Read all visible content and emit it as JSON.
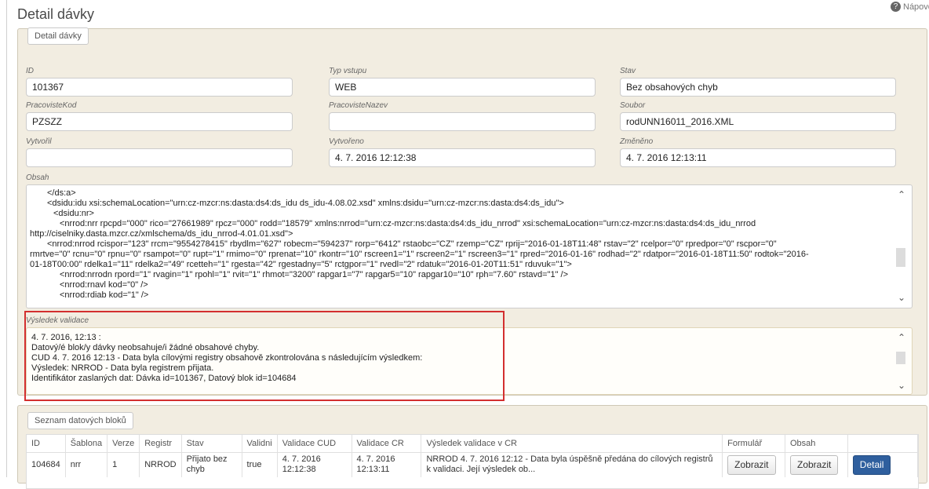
{
  "page": {
    "title": "Detail dávky",
    "help_label": "Nápověda"
  },
  "detail": {
    "legend": "Detail dávky",
    "fields": {
      "id": {
        "label": "ID",
        "value": "101367"
      },
      "typ_vstupu": {
        "label": "Typ vstupu",
        "value": "WEB"
      },
      "stav": {
        "label": "Stav",
        "value": "Bez obsahových chyb"
      },
      "pracoviste_kod": {
        "label": "PracovisteKod",
        "value": "PZSZZ"
      },
      "pracoviste_nazev": {
        "label": "PracovisteNazev",
        "value": ""
      },
      "soubor": {
        "label": "Soubor",
        "value": "rodUNN16011_2016.XML"
      },
      "vytvoril": {
        "label": "Vytvořil",
        "value": ""
      },
      "vytvoreno": {
        "label": "Vytvořeno",
        "value": "4. 7. 2016 12:12:38"
      },
      "zmeneno": {
        "label": "Změněno",
        "value": "4. 7. 2016 12:13:11"
      }
    },
    "obsah": {
      "label": "Obsah",
      "lines": [
        "</ds:a>",
        "<dsidu:idu xsi:schemaLocation=\"urn:cz-mzcr:ns:dasta:ds4:ds_idu ds_idu-4.08.02.xsd\" xmlns:dsidu=\"urn:cz-mzcr:ns:dasta:ds4:ds_idu\">",
        "<dsidu:nr>",
        "<nrrod:nrr rpcpd=\"000\" rico=\"27661989\" rpcz=\"000\" rodd=\"18579\" xmlns:nrrod=\"urn:cz-mzcr:ns:dasta:ds4:ds_idu_nrrod\" xsi:schemaLocation=\"urn:cz-mzcr:ns:dasta:ds4:ds_idu_nrrod",
        "http://ciselniky.dasta.mzcr.cz/xmlschema/ds_idu_nrrod-4.01.01.xsd\">",
        "<nrrod:nrrod rcispor=\"123\" rrcm=\"9554278415\" rbydlm=\"627\" robecm=\"594237\" rorp=\"6412\" rstaobc=\"CZ\" rzemp=\"CZ\" rprij=\"2016-01-18T11:48\" rstav=\"2\" rcelpor=\"0\" rpredpor=\"0\" rscpor=\"0\"",
        "rmrtve=\"0\" rcnu=\"0\" rpnu=\"0\" rsampot=\"0\" rupt=\"1\" rmimo=\"0\" rprenat=\"10\" rkontr=\"10\" rscreen1=\"1\" rscreen2=\"1\" rscreen3=\"1\" rpred=\"2016-01-16\" rodhad=\"2\" rdatpor=\"2016-01-18T11:50\" rodtok=\"2016-",
        "01-18T00:00\" rdelka1=\"11\" rdelka2=\"49\" rcetteh=\"1\" rgesta=\"42\" rgestadny=\"5\" rctgpor=\"1\" rvedl=\"2\" rdatuk=\"2016-01-20T11:51\" rduvuk=\"1\">",
        "<nrrod:nrrodn rpord=\"1\" rvagin=\"1\" rpohl=\"1\" rvit=\"1\" rhmot=\"3200\" rapgar1=\"7\" rapgar5=\"10\" rapgar10=\"10\" rph=\"7.60\" rstavd=\"1\" />",
        "<nrrod:rnavl kod=\"0\" />",
        "<nrrod:rdiab kod=\"1\" />"
      ]
    },
    "validace": {
      "label": "Výsledek validace",
      "lines": [
        "4. 7. 2016, 12:13 :",
        "Datový/é blok/y dávky neobsahuje/i žádné obsahové chyby.",
        "CUD 4. 7. 2016 12:13 - Data byla cílovými registry obsahově zkontrolována s následujícím výsledkem:",
        "Výsledek: NRROD - Data byla registrem přijata.",
        "Identifikátor zaslaných dat: Dávka id=101367, Datový blok id=104684"
      ]
    }
  },
  "bloky": {
    "legend": "Seznam datových bloků",
    "columns": [
      "ID",
      "Šablona",
      "Verze",
      "Registr",
      "Stav",
      "Validni",
      "Validace CUD",
      "Validace CR",
      "Výsledek validace v CR",
      "Formulář",
      "Obsah",
      ""
    ],
    "rows": [
      {
        "id": "104684",
        "sablona": "nrr",
        "verze": "1",
        "registr": "NRROD",
        "stav": "Přijato bez chyb",
        "validni": "true",
        "validace_cud": "4. 7. 2016 12:12:38",
        "validace_cr": "4. 7. 2016 12:13:11",
        "vysledek": "NRROD 4. 7. 2016 12:12 - Data byla úspěšně předána do cílových registrů k validaci. Její výsledek ob...",
        "formular_btn": "Zobrazit",
        "obsah_btn": "Zobrazit",
        "detail_btn": "Detail"
      }
    ]
  }
}
